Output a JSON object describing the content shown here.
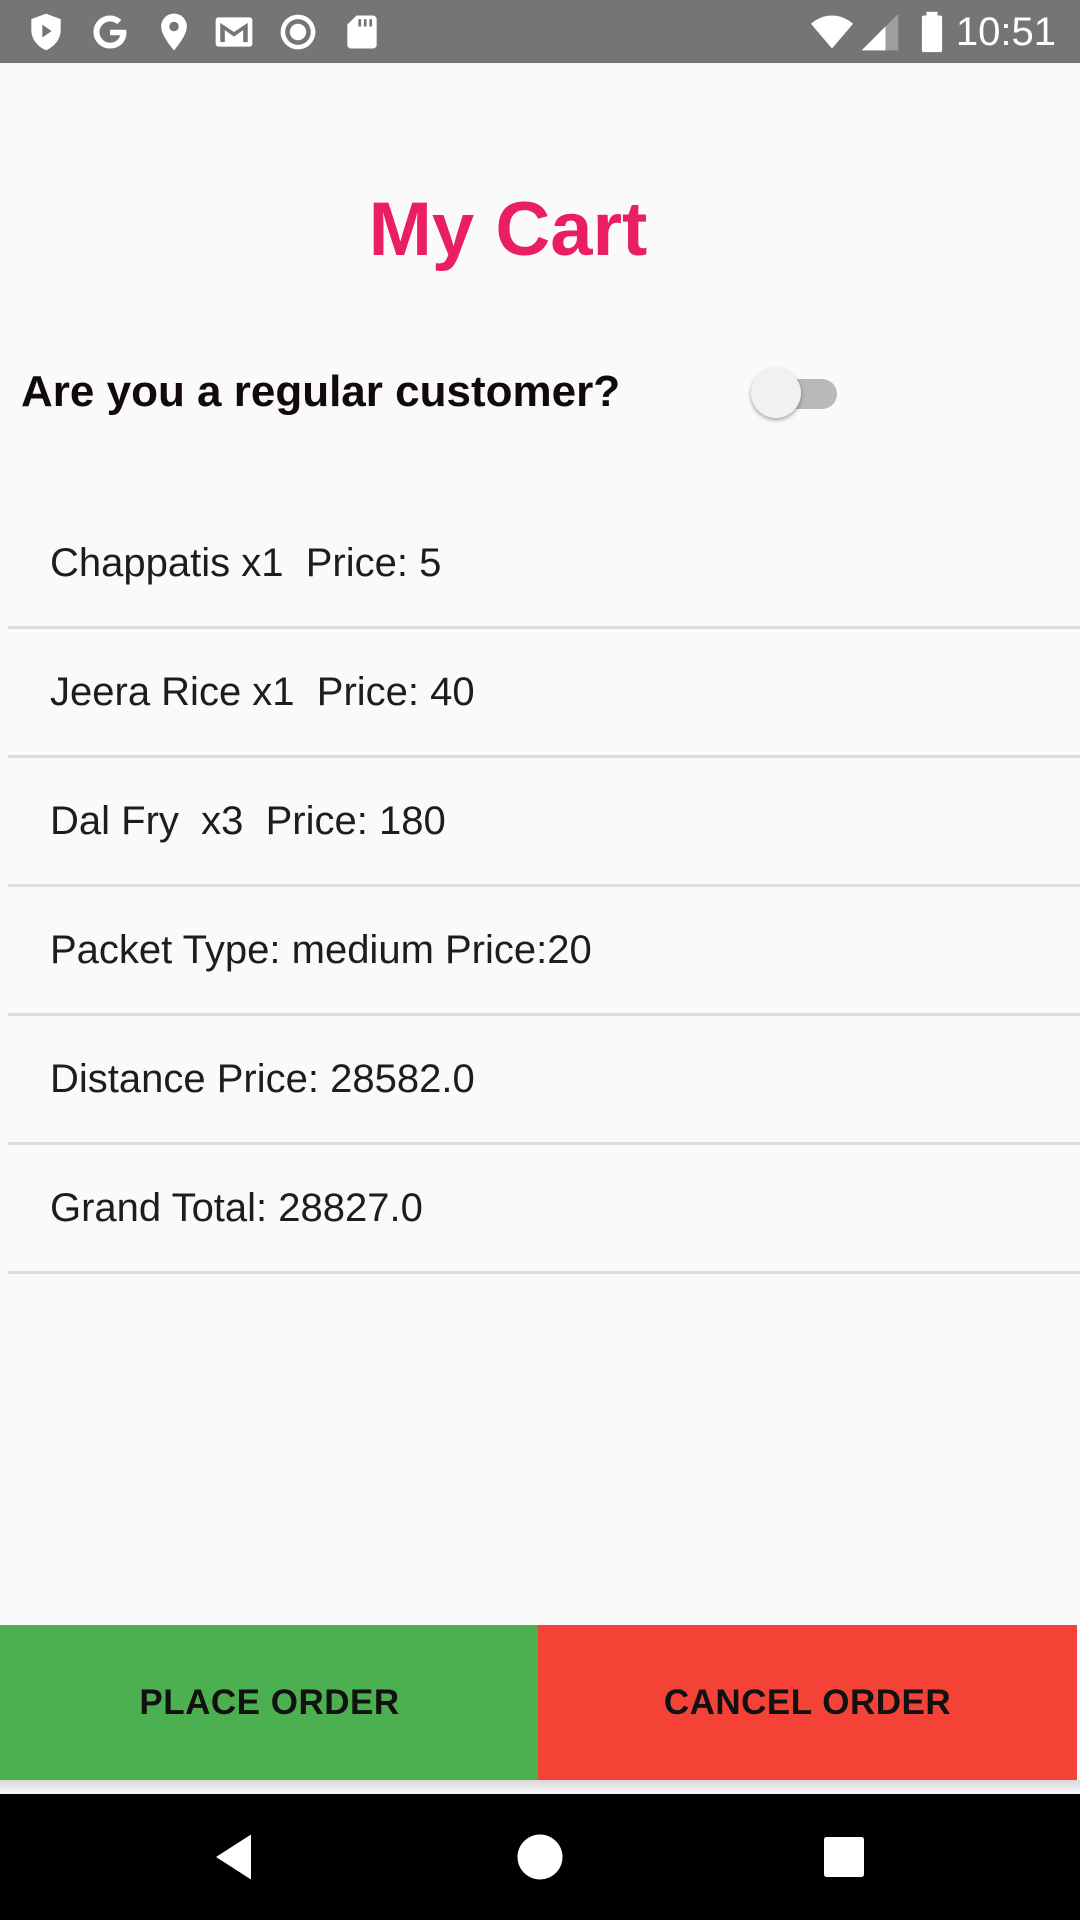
{
  "status_bar": {
    "time": "10:51",
    "left_icons": [
      "shield-play-icon",
      "google-icon",
      "location-pin-icon",
      "gmail-icon",
      "record-icon",
      "sd-card-icon"
    ],
    "right_icons": [
      "wifi-icon",
      "cell-signal-icon",
      "battery-icon"
    ]
  },
  "page": {
    "title": "My Cart",
    "title_color": "#e91e63"
  },
  "regular_customer": {
    "question": "Are you a regular customer?",
    "toggle_on": false
  },
  "cart": {
    "items": [
      {
        "text": "Chappatis x1  Price: 5"
      },
      {
        "text": "Jeera Rice x1  Price: 40"
      },
      {
        "text": "Dal Fry  x3  Price: 180"
      },
      {
        "text": "Packet Type: medium Price:20"
      },
      {
        "text": "Distance Price: 28582.0"
      },
      {
        "text": "Grand Total: 28827.0"
      }
    ]
  },
  "actions": {
    "place_order_label": "PLACE ORDER",
    "place_order_color": "#4caf50",
    "cancel_order_label": "CANCEL ORDER",
    "cancel_order_color": "#f44336"
  },
  "nav_bar": {
    "buttons": [
      "back-icon",
      "home-icon",
      "recents-icon"
    ]
  }
}
